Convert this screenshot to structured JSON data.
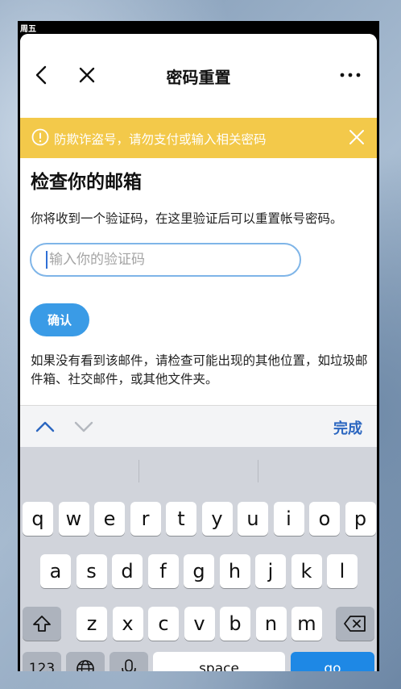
{
  "status_bar": {
    "day": "周五"
  },
  "nav": {
    "title": "密码重置",
    "back_icon": "chevron-left-icon",
    "close_icon": "close-icon",
    "more_icon": "more-horizontal-icon"
  },
  "warning": {
    "text": "防欺诈盗号，请勿支付或输入相关密码",
    "bg_color": "#f3c94a"
  },
  "main": {
    "heading": "检查你的邮箱",
    "description": "你将收到一个验证码，在这里验证后可以重置帐号密码。",
    "code_placeholder": "输入你的验证码",
    "confirm_label": "确认",
    "hint": "如果没有看到该邮件，请检查可能出现的其他位置，如垃圾邮件箱、社交邮件，或其他文件夹。"
  },
  "accessory": {
    "done_label": "完成"
  },
  "keyboard": {
    "row1": [
      "q",
      "w",
      "e",
      "r",
      "t",
      "y",
      "u",
      "i",
      "o",
      "p"
    ],
    "row2": [
      "a",
      "s",
      "d",
      "f",
      "g",
      "h",
      "j",
      "k",
      "l"
    ],
    "row3": [
      "z",
      "x",
      "c",
      "v",
      "b",
      "n",
      "m"
    ],
    "num_label": "123",
    "space_label": "space",
    "go_label": "go",
    "accent_color": "#1e88e5"
  }
}
